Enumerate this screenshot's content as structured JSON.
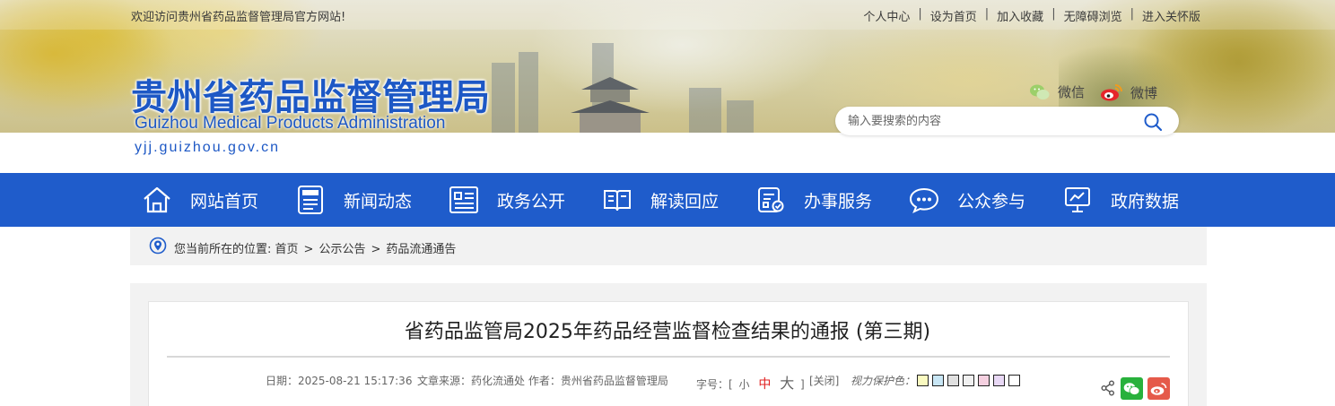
{
  "topbar": {
    "welcome": "欢迎访问贵州省药品监督管理局官方网站!",
    "links": [
      "个人中心",
      "设为首页",
      "加入收藏",
      "无障碍浏览",
      "进入关怀版"
    ]
  },
  "logo": {
    "name_cn": "贵州省药品监督管理局",
    "name_en": "Guizhou Medical Products Administration",
    "url": "yjj.guizhou.gov.cn"
  },
  "social": {
    "wechat": "微信",
    "weibo": "微博"
  },
  "search": {
    "placeholder": "输入要搜索的内容",
    "icon": "search-icon"
  },
  "nav": [
    {
      "label": "网站首页",
      "icon": "home-icon"
    },
    {
      "label": "新闻动态",
      "icon": "news-icon"
    },
    {
      "label": "政务公开",
      "icon": "document-list-icon"
    },
    {
      "label": "解读回应",
      "icon": "open-book-icon"
    },
    {
      "label": "办事服务",
      "icon": "service-form-icon"
    },
    {
      "label": "公众参与",
      "icon": "chat-bubble-icon"
    },
    {
      "label": "政府数据",
      "icon": "data-screen-icon"
    }
  ],
  "breadcrumb": {
    "prefix": "您当前所在的位置:",
    "items": [
      "首页",
      "公示公告",
      "药品流通通告"
    ]
  },
  "article": {
    "title": "省药品监管局2025年药品经营监督检查结果的通报 (第三期)",
    "date": "日期：2025-08-21 15:17:36",
    "source": "文章来源：药化流通处 作者：贵州省药品监督管理局",
    "font_size": {
      "label": "字号：[",
      "small": "小",
      "medium": "中",
      "large": "大",
      "close_bracket": "]"
    },
    "close": "[关闭]",
    "eye_care": {
      "label": "视力保护色：",
      "colors": [
        "#fafac0",
        "#c8e6f5",
        "#e0e0e0",
        "#f0f0f0",
        "#f5d0e0",
        "#e8d8f5",
        "#ffffff"
      ]
    }
  },
  "colors": {
    "brand_blue": "#1f5ccb",
    "wechat_green": "#28b13c",
    "weibo_red": "#e55a4a"
  }
}
